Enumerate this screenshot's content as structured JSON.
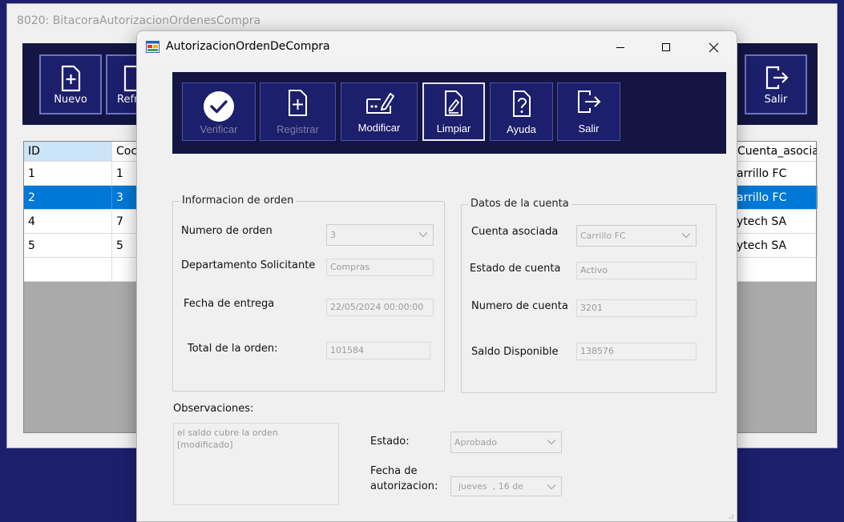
{
  "background_window": {
    "title": "8020: BitacoraAutorizacionOrdenesCompra",
    "toolbar": {
      "new_label": "Nuevo",
      "refresh_label": "Refre",
      "exit_label": "Salir"
    },
    "grid": {
      "headers": {
        "id": "ID",
        "code": "Coc",
        "account": "Cuenta_asociada"
      },
      "rows": [
        {
          "id": "1",
          "code": "1",
          "account": "arrillo FC",
          "selected": false
        },
        {
          "id": "2",
          "code": "3",
          "account": "arrillo FC",
          "selected": true
        },
        {
          "id": "4",
          "code": "7",
          "account": "ytech SA",
          "selected": false
        },
        {
          "id": "5",
          "code": "5",
          "account": "ytech SA",
          "selected": false
        }
      ]
    }
  },
  "dialog": {
    "title": "AutorizacionOrdenDeCompra",
    "toolbar": {
      "verify": "Verificar",
      "register": "Registrar",
      "modify": "Modificar",
      "clear": "Limpiar",
      "help": "Ayuda",
      "exit": "Salir"
    },
    "order_group": {
      "title": "Informacion de orden",
      "order_number_label": "Numero de orden",
      "order_number_value": "3",
      "department_label": "Departamento Solicitante",
      "department_value": "Compras",
      "delivery_date_label": "Fecha de entrega",
      "delivery_date_value": "22/05/2024 00:00:00",
      "total_label": "Total de la orden:",
      "total_value": "101584"
    },
    "account_group": {
      "title": "Datos de la cuenta",
      "account_label": "Cuenta asociada",
      "account_value": "Carrillo FC",
      "status_label": "Estado de cuenta",
      "status_value": "Activo",
      "number_label": "Numero de cuenta",
      "number_value": "3201",
      "balance_label": "Saldo Disponible",
      "balance_value": "138576"
    },
    "observations_label": "Observaciones:",
    "observations_line1": "el saldo cubre la orden",
    "observations_line2": "[modificado]",
    "state_label": "Estado:",
    "state_value": "Aprobado",
    "auth_date_label_1": "Fecha de",
    "auth_date_label_2": "autorizacion:",
    "auth_date_value": "jueves  , 16 de"
  },
  "colors": {
    "toolbar_bg": "#141543",
    "button_bg": "#1c1f6b",
    "selection": "#0078d7",
    "desktop": "#1c1f6b"
  }
}
